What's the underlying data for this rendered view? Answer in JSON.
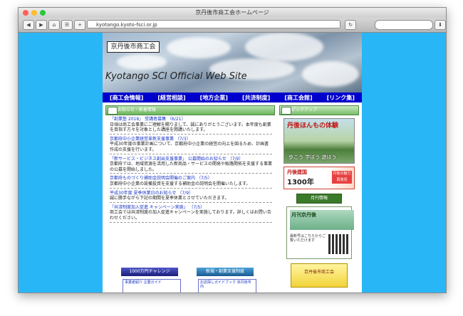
{
  "browser": {
    "title": "京丹後市商工会ホームページ",
    "url": "kyotango.kyoto-fsci.or.jp"
  },
  "site": {
    "logo_text": "京丹後市商工会",
    "site_title": "Kyotango SCI Official Web Site",
    "nav": [
      "[商工会情報]",
      "[経営相談]",
      "[地方企業]",
      "[共済制度]",
      "[商工会館]",
      "[リンク集]"
    ]
  },
  "news": {
    "header": "お知らせ・新着情報",
    "items": [
      {
        "title": "「創業塾 2018」 受講者募集",
        "date": "（6/21）",
        "body": "日頃は商工会事業にご理解を賜りまして、誠にありがとうございます。本年度も創業を目指す方々を対象とした講座を開講いたします。"
      },
      {
        "title": "京都府中小企業経営革新支援事業",
        "date": "（7/3）",
        "body": "平成30年度の事業計画について、京都府中小企業の経営の向上を図るため、計画書作成の支援を行います。"
      },
      {
        "title": "「新サービス・ビジネス創出支援事業」 公募開始のお知らせ",
        "date": "（7/9）",
        "body": "京都府では、地域資源を活用した新商品・サービスの開発や販路開拓を支援する事業の公募を開始しました。"
      },
      {
        "title": "京都府ものづくり補助金説明会開催のご案内",
        "date": "（7/5）",
        "body": "京都府中小企業の設備投資を支援する補助金の説明会を開催いたします。"
      },
      {
        "title": "平成30年度 夏季休業日のお知らせ",
        "date": "（7/9）",
        "body": "誠に勝手ながら下記の期間を夏季休業とさせていただきます。"
      },
      {
        "title": "「共済制度加入促進 キャンペーン実施」",
        "date": "（7/5）",
        "body": "商工会では共済制度の加入促進キャンペーンを実施しております。詳しくはお問い合わせください。"
      }
    ]
  },
  "right": {
    "header": "ピックアップ",
    "promo1_title": "丹後ほんもの体験",
    "promo1_sub": "歩こう 学ぼう 遊ぼう",
    "promo2_title": "丹後建国",
    "promo2_years": "1300年",
    "promo2_badge": "丹後の魅力 再発見",
    "minihead": "月刊情報",
    "promo3_title": "月刊京丹後",
    "promo3_qr_text": "最新号はこちらからご覧いただけます",
    "promo4_text": "京丹後市商工会"
  },
  "bottom": {
    "btn1": "1000万円チャレンジ",
    "btn2": "新規・創業支援制度",
    "box1": "事業者紹介 企業ガイド",
    "box2": "お店探しガイドブック 京丹後市内"
  },
  "colors": {
    "desktop": "#29b6f6",
    "nav": "#0000cc",
    "link": "#1a36c8"
  }
}
